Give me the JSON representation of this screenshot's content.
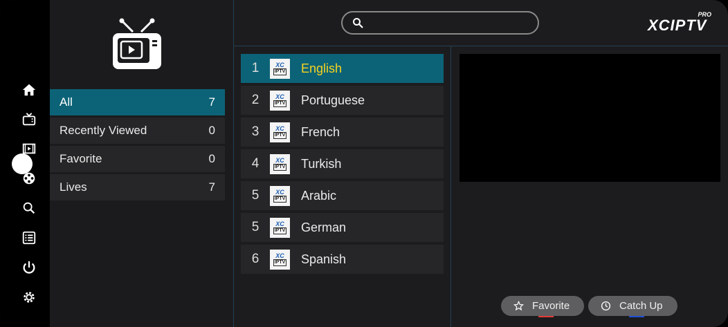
{
  "brand": {
    "name": "XCIPTV",
    "badge": "PRO"
  },
  "search": {
    "placeholder": ""
  },
  "rail": {
    "items": [
      {
        "icon": "home-icon"
      },
      {
        "icon": "live-tv-icon"
      },
      {
        "icon": "movies-icon"
      },
      {
        "icon": "series-reel-icon"
      },
      {
        "icon": "search-icon"
      },
      {
        "icon": "list-icon"
      },
      {
        "icon": "power-icon"
      },
      {
        "icon": "settings-gear-icon"
      }
    ]
  },
  "categories": [
    {
      "label": "All",
      "count": "7",
      "active": true
    },
    {
      "label": "Recently Viewed",
      "count": "0",
      "active": false
    },
    {
      "label": "Favorite",
      "count": "0",
      "active": false
    },
    {
      "label": "Lives",
      "count": "7",
      "active": false
    }
  ],
  "channels": [
    {
      "number": "1",
      "name": "English",
      "logo_top": "XC",
      "logo_bottom": "IPTV",
      "active": true
    },
    {
      "number": "2",
      "name": "Portuguese",
      "logo_top": "XC",
      "logo_bottom": "IPTV",
      "active": false
    },
    {
      "number": "3",
      "name": "French",
      "logo_top": "XC",
      "logo_bottom": "IPTV",
      "active": false
    },
    {
      "number": "4",
      "name": "Turkish",
      "logo_top": "XC",
      "logo_bottom": "IPTV",
      "active": false
    },
    {
      "number": "5",
      "name": "Arabic",
      "logo_top": "XC",
      "logo_bottom": "IPTV",
      "active": false
    },
    {
      "number": "5",
      "name": "German",
      "logo_top": "XC",
      "logo_bottom": "IPTV",
      "active": false
    },
    {
      "number": "6",
      "name": "Spanish",
      "logo_top": "XC",
      "logo_bottom": "IPTV",
      "active": false
    }
  ],
  "actions": {
    "favorite_label": "Favorite",
    "catchup_label": "Catch Up"
  },
  "colors": {
    "accent_active": "#0c6377",
    "active_text": "#f6d320",
    "favorite_indicator": "#e53935",
    "catchup_indicator": "#1e4fd8"
  }
}
